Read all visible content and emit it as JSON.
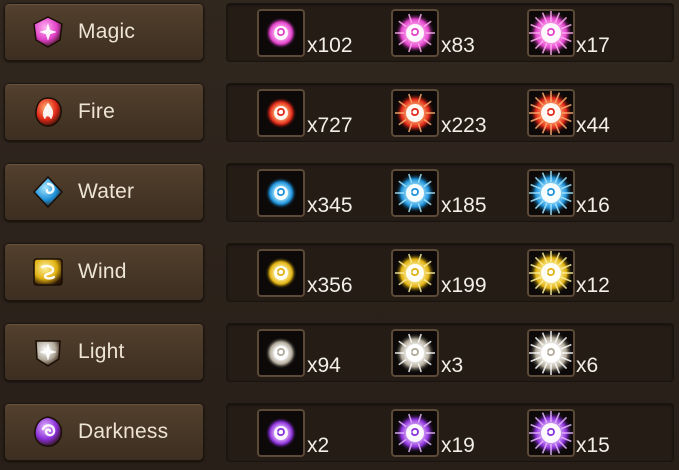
{
  "rows": [
    {
      "name": "Magic",
      "icon": "magic-rune-icon",
      "color": "#e040c8",
      "light": "#ffb0f0",
      "essences": [
        {
          "tier": "low",
          "count": "x102"
        },
        {
          "tier": "mid",
          "count": "x83"
        },
        {
          "tier": "high",
          "count": "x17"
        }
      ]
    },
    {
      "name": "Fire",
      "icon": "fire-rune-icon",
      "color": "#e02818",
      "light": "#ffb070",
      "essences": [
        {
          "tier": "low",
          "count": "x727"
        },
        {
          "tier": "mid",
          "count": "x223"
        },
        {
          "tier": "high",
          "count": "x44"
        }
      ]
    },
    {
      "name": "Water",
      "icon": "water-rune-icon",
      "color": "#1e90d8",
      "light": "#a8e8ff",
      "essences": [
        {
          "tier": "low",
          "count": "x345"
        },
        {
          "tier": "mid",
          "count": "x185"
        },
        {
          "tier": "high",
          "count": "x16"
        }
      ]
    },
    {
      "name": "Wind",
      "icon": "wind-rune-icon",
      "color": "#e0b010",
      "light": "#fff2a0",
      "essences": [
        {
          "tier": "low",
          "count": "x356"
        },
        {
          "tier": "mid",
          "count": "x199"
        },
        {
          "tier": "high",
          "count": "x12"
        }
      ]
    },
    {
      "name": "Light",
      "icon": "light-rune-icon",
      "color": "#b0a898",
      "light": "#ffffff",
      "essences": [
        {
          "tier": "low",
          "count": "x94"
        },
        {
          "tier": "mid",
          "count": "x3"
        },
        {
          "tier": "high",
          "count": "x6"
        }
      ]
    },
    {
      "name": "Darkness",
      "icon": "darkness-rune-icon",
      "color": "#8a30d8",
      "light": "#e6b8ff",
      "essences": [
        {
          "tier": "low",
          "count": "x2"
        },
        {
          "tier": "mid",
          "count": "x19"
        },
        {
          "tier": "high",
          "count": "x15"
        }
      ]
    }
  ]
}
